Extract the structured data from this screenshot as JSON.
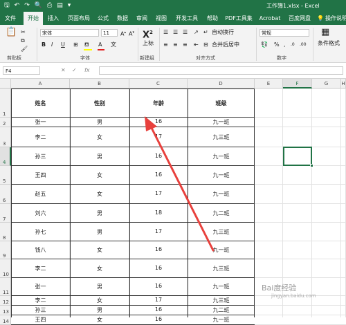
{
  "titlebar": {
    "qat_icons": [
      "save-icon",
      "undo-icon",
      "redo-icon",
      "print-preview-icon",
      "quick-print-icon",
      "shape-icon",
      "more-icon"
    ],
    "qat_glyphs": [
      "🖫",
      "↶",
      "↷",
      "🔍",
      "⎙",
      "▤",
      "▾"
    ],
    "title": "工作簿1.xlsx  -  Excel"
  },
  "tabs": [
    "文件",
    "开始",
    "插入",
    "页面布局",
    "公式",
    "数据",
    "审阅",
    "视图",
    "开发工具",
    "帮助",
    "PDF工具集",
    "Acrobat",
    "百度网盘",
    "💡",
    "操作说明"
  ],
  "active_tab": 1,
  "ribbon": {
    "font_name": "宋体",
    "font_size": "11",
    "bold": "B",
    "italic": "I",
    "underline": "U",
    "font_color_glyph": "A",
    "superscript_glyph": "X",
    "superscript_label": "上标",
    "wrap_text": "自动换行",
    "merge_center": "合并后居中",
    "number_format": "常规",
    "percent": "%",
    "comma": ",",
    "cond_format": "条件格式",
    "groups": [
      "剪贴板",
      "字体",
      "新建组",
      "对齐方式",
      "数字"
    ]
  },
  "formula_bar": {
    "cell_ref": "F4",
    "fx": "fx",
    "cancel": "✕",
    "enter": "✓",
    "value": ""
  },
  "columns": [
    "A",
    "B",
    "C",
    "D",
    "E",
    "F",
    "G",
    "H"
  ],
  "selected_column": "F",
  "rows": [
    "1",
    "2",
    "3",
    "4",
    "5",
    "6",
    "7",
    "8",
    "9",
    "10",
    "11",
    "12",
    "13",
    "14"
  ],
  "selected_row": "4",
  "table": {
    "headers": [
      "姓名",
      "性别",
      "年龄",
      "班级"
    ],
    "data": [
      [
        "张一",
        "男",
        "16",
        "九一班"
      ],
      [
        "李二",
        "女",
        "17",
        "九三班"
      ],
      [
        "孙三",
        "男",
        "16",
        "九一班"
      ],
      [
        "王四",
        "女",
        "16",
        "九一班"
      ],
      [
        "赵五",
        "女",
        "17",
        "九一班"
      ],
      [
        "刘六",
        "男",
        "18",
        "九二班"
      ],
      [
        "孙七",
        "男",
        "17",
        "九三班"
      ],
      [
        "钱八",
        "女",
        "16",
        "九一班"
      ],
      [
        "李二",
        "女",
        "16",
        "九三班"
      ],
      [
        "张一",
        "男",
        "16",
        "九一班"
      ],
      [
        "李二",
        "女",
        "17",
        "九三班"
      ],
      [
        "孙三",
        "男",
        "16",
        "九二班"
      ],
      [
        "王四",
        "女",
        "16",
        "九一班"
      ]
    ]
  },
  "annotation_color": "#e8413d",
  "accent_color": "#217346",
  "watermark": {
    "text": "Bai度经验",
    "sub": "jingyan.baidu.com"
  }
}
